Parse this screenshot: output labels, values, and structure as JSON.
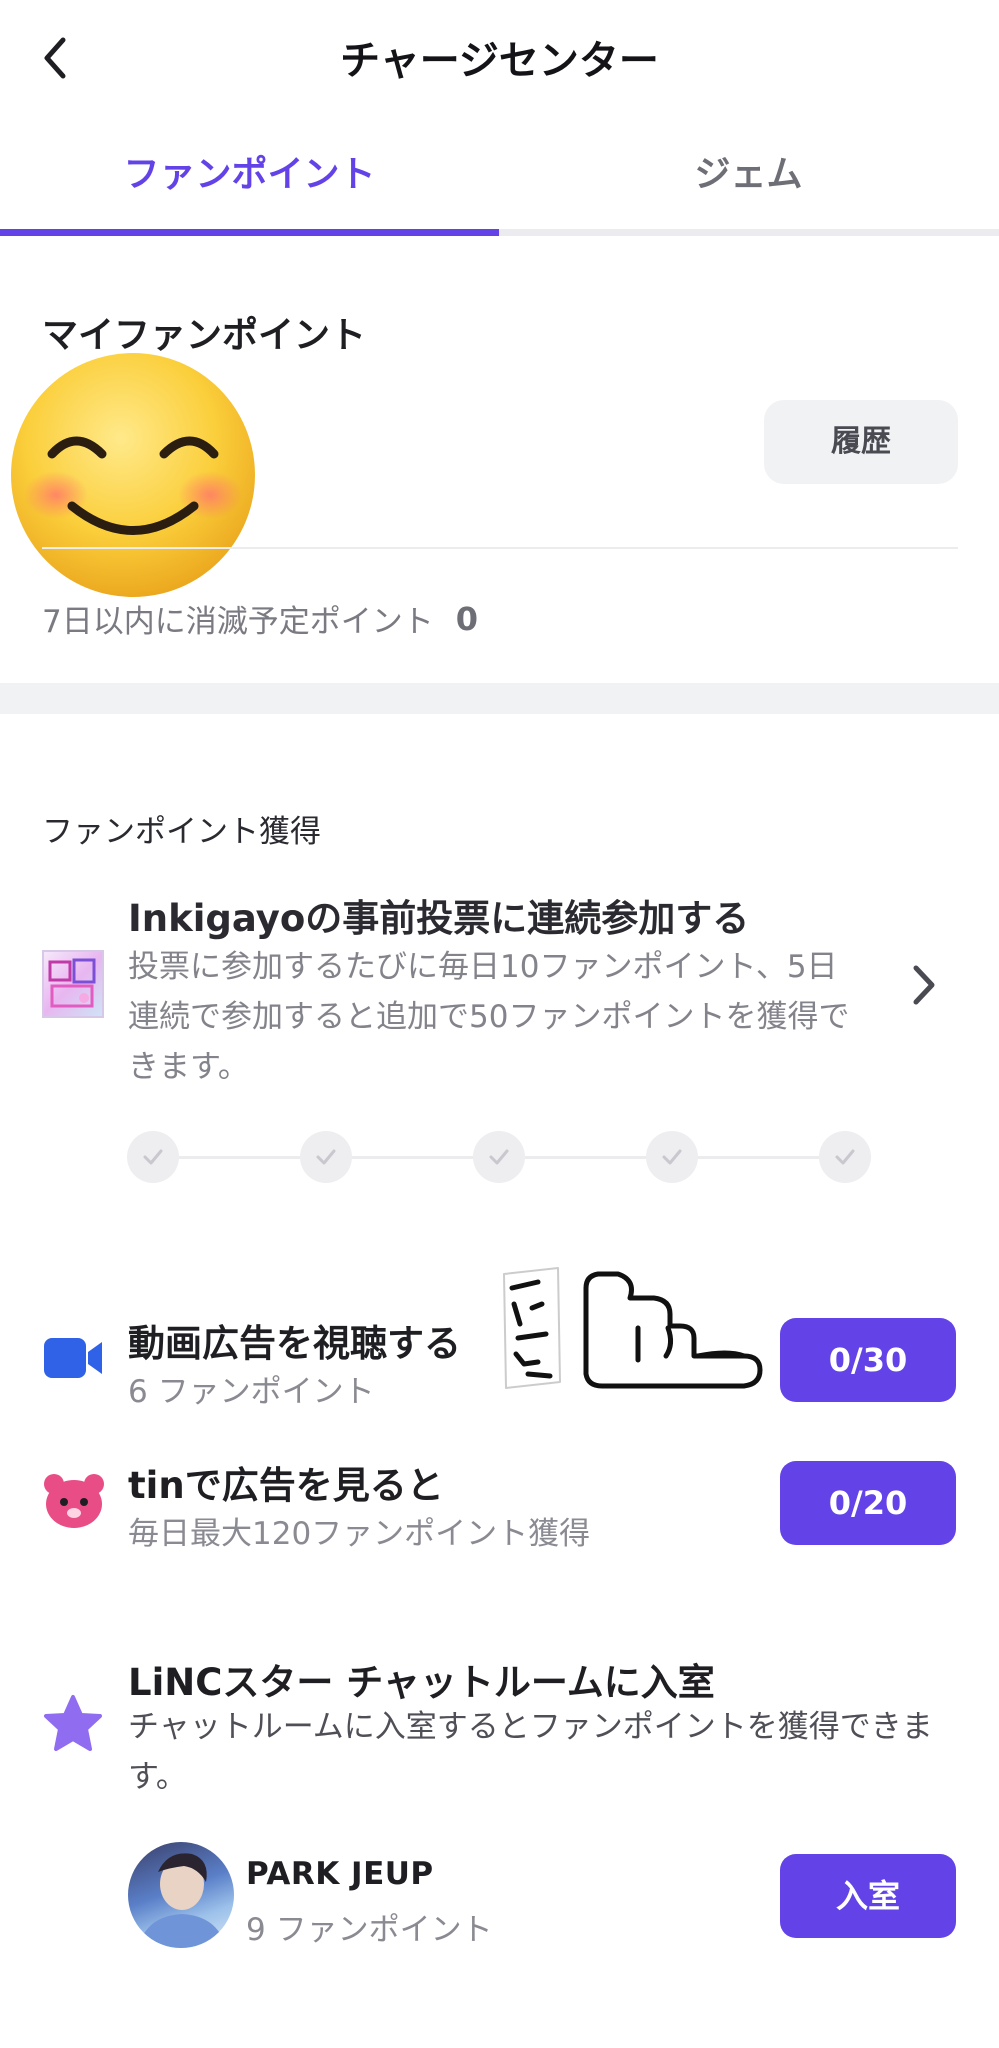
{
  "header": {
    "title": "チャージセンター"
  },
  "tabs": [
    {
      "label": "ファンポイント",
      "active": true
    },
    {
      "label": "ジェム",
      "active": false
    }
  ],
  "my_points": {
    "title": "マイファンポイント",
    "history_label": "履歴",
    "expiring_label": "7日以内に消滅予定ポイント",
    "expiring_value": "0"
  },
  "earn": {
    "title": "ファンポイント獲得",
    "vote": {
      "title": "Inkigayoの事前投票に連続参加する",
      "description": "投票に参加するたびに毎日10ファンポイント、5日連続で参加すると追加で50ファンポイントを獲得できます。",
      "days_completed": 0,
      "total_days": 5
    },
    "video_ad": {
      "title": "動画広告を視聴する",
      "points": "6 ファンポイント",
      "progress": "0/30"
    },
    "tin_ad": {
      "title": "tinで広告を見ると",
      "subtitle": "毎日最大120ファンポイント獲得",
      "progress": "0/20"
    },
    "linc": {
      "title": "LiNCスター チャットルームに入室",
      "description": "チャットルームに入室するとファンポイントを獲得できます。",
      "star_name": "PARK JEUP",
      "star_points": "9 ファンポイント",
      "enter_label": "入室"
    }
  },
  "colors": {
    "accent": "#6343e8",
    "video_icon": "#2f62e6",
    "tin_icon": "#e84d86",
    "star_icon": "#8f6cf0"
  }
}
